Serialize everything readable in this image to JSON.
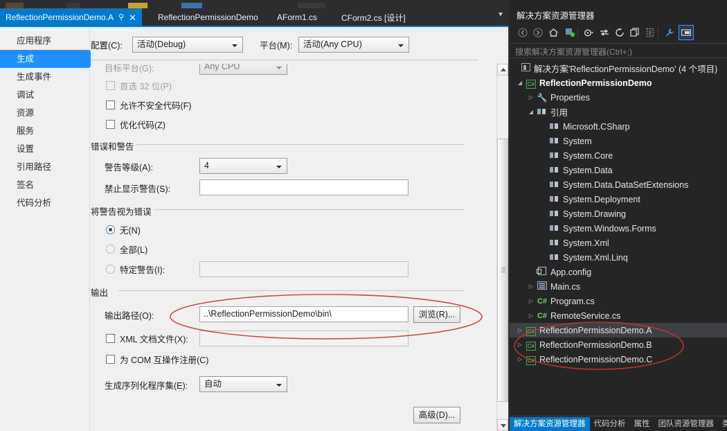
{
  "window": {
    "accent_color": "#007acc",
    "dark_bg": "#2d2d30",
    "panel_bg": "#252526",
    "light_bg": "#f0f0f0",
    "annotation_color": "#c0392b"
  },
  "tabs": {
    "items": [
      {
        "label": "ReflectionPermissionDemo.A",
        "active": true
      },
      {
        "label": "ReflectionPermissionDemo",
        "active": false
      },
      {
        "label": "AForm1.cs",
        "active": false
      },
      {
        "label": "CForm2.cs [设计]",
        "active": false
      }
    ],
    "pin_icon": "pin-icon",
    "close_icon": "close-icon",
    "overflow_icon": "chevron-down-icon"
  },
  "categories": {
    "items": [
      {
        "label": "应用程序",
        "selected": false
      },
      {
        "label": "生成",
        "selected": true
      },
      {
        "label": "生成事件",
        "selected": false
      },
      {
        "label": "调试",
        "selected": false
      },
      {
        "label": "资源",
        "selected": false
      },
      {
        "label": "服务",
        "selected": false
      },
      {
        "label": "设置",
        "selected": false
      },
      {
        "label": "引用路径",
        "selected": false
      },
      {
        "label": "签名",
        "selected": false
      },
      {
        "label": "代码分析",
        "selected": false
      }
    ]
  },
  "build_page": {
    "configuration_label": "配置(C):",
    "configuration_value": "活动(Debug)",
    "platform_label": "平台(M):",
    "platform_value": "活动(Any CPU)",
    "target_platform_label": "目标平台(G):",
    "target_platform_value": "Any CPU",
    "prefer32_label": "首选 32 位(P)",
    "prefer32_checked": false,
    "prefer32_disabled": true,
    "unsafe_label": "允许不安全代码(F)",
    "unsafe_checked": false,
    "optimize_label": "优化代码(Z)",
    "optimize_checked": false,
    "errors_group": "错误和警告",
    "warn_level_label": "警告等级(A):",
    "warn_level_value": "4",
    "suppress_warn_label": "禁止显示警告(S):",
    "suppress_warn_value": "",
    "warn_as_error_group": "将警告视为错误",
    "radio_none": "无(N)",
    "radio_all": "全部(L)",
    "radio_specific": "特定警告(I):",
    "radio_selected": "none",
    "specific_warn_value": "",
    "output_group": "输出",
    "output_path_label": "输出路径(O):",
    "output_path_value": "..\\ReflectionPermissionDemo\\bin\\",
    "browse_button": "浏览(R)...",
    "xml_doc_label": "XML 文档文件(X):",
    "xml_doc_checked": false,
    "xml_doc_value": "",
    "com_interop_label": "为 COM 互操作注册(C)",
    "com_interop_checked": false,
    "serialization_label": "生成序列化程序集(E):",
    "serialization_value": "自动",
    "advanced_button": "高级(D)..."
  },
  "solution_explorer": {
    "title": "解决方案资源管理器",
    "search_placeholder": "搜索解决方案资源管理器(Ctrl+;)",
    "toolbar": [
      {
        "name": "back-icon",
        "glyph": "◀"
      },
      {
        "name": "forward-icon",
        "glyph": "▶"
      },
      {
        "name": "home-icon",
        "glyph": "⌂"
      },
      {
        "name": "pending-changes-icon",
        "glyph": "◈"
      },
      {
        "name": "sync-views-icon",
        "glyph": "◷"
      },
      {
        "name": "refresh-icon",
        "glyph": "⇄"
      },
      {
        "name": "collapse-all-icon",
        "glyph": "⟳"
      },
      {
        "name": "show-all-files-icon",
        "glyph": "❐"
      },
      {
        "name": "preview-selected-items-icon",
        "glyph": "▤"
      },
      {
        "name": "properties-icon",
        "glyph": "🔧"
      },
      {
        "name": "properties-window-icon",
        "glyph": "▭"
      }
    ],
    "tree": [
      {
        "label": "解决方案'ReflectionPermissionDemo' (4 个项目)",
        "indent": 0,
        "twist": "none",
        "icon": "solution-icon",
        "bold": false,
        "selected": false
      },
      {
        "label": "ReflectionPermissionDemo",
        "indent": 1,
        "twist": "open",
        "icon": "csproj-icon",
        "bold": true,
        "selected": false
      },
      {
        "label": "Properties",
        "indent": 2,
        "twist": "closed",
        "icon": "wrench-icon",
        "bold": false,
        "selected": false
      },
      {
        "label": "引用",
        "indent": 2,
        "twist": "open",
        "icon": "references-icon",
        "bold": false,
        "selected": false
      },
      {
        "label": "Microsoft.CSharp",
        "indent": 3,
        "twist": "none",
        "icon": "reference-icon",
        "bold": false,
        "selected": false
      },
      {
        "label": "System",
        "indent": 3,
        "twist": "none",
        "icon": "reference-icon",
        "bold": false,
        "selected": false
      },
      {
        "label": "System.Core",
        "indent": 3,
        "twist": "none",
        "icon": "reference-icon",
        "bold": false,
        "selected": false
      },
      {
        "label": "System.Data",
        "indent": 3,
        "twist": "none",
        "icon": "reference-icon",
        "bold": false,
        "selected": false
      },
      {
        "label": "System.Data.DataSetExtensions",
        "indent": 3,
        "twist": "none",
        "icon": "reference-icon",
        "bold": false,
        "selected": false
      },
      {
        "label": "System.Deployment",
        "indent": 3,
        "twist": "none",
        "icon": "reference-icon",
        "bold": false,
        "selected": false
      },
      {
        "label": "System.Drawing",
        "indent": 3,
        "twist": "none",
        "icon": "reference-icon",
        "bold": false,
        "selected": false
      },
      {
        "label": "System.Windows.Forms",
        "indent": 3,
        "twist": "none",
        "icon": "reference-icon",
        "bold": false,
        "selected": false
      },
      {
        "label": "System.Xml",
        "indent": 3,
        "twist": "none",
        "icon": "reference-icon",
        "bold": false,
        "selected": false
      },
      {
        "label": "System.Xml.Linq",
        "indent": 3,
        "twist": "none",
        "icon": "reference-icon",
        "bold": false,
        "selected": false
      },
      {
        "label": "App.config",
        "indent": 2,
        "twist": "none",
        "icon": "config-icon",
        "bold": false,
        "selected": false
      },
      {
        "label": "Main.cs",
        "indent": 2,
        "twist": "closed",
        "icon": "form-icon",
        "bold": false,
        "selected": false
      },
      {
        "label": "Program.cs",
        "indent": 2,
        "twist": "closed",
        "icon": "cs-file-icon",
        "bold": false,
        "selected": false
      },
      {
        "label": "RemoteService.cs",
        "indent": 2,
        "twist": "closed",
        "icon": "cs-file-icon",
        "bold": false,
        "selected": false
      },
      {
        "label": "ReflectionPermissionDemo.A",
        "indent": 1,
        "twist": "closed",
        "icon": "csproj-icon",
        "bold": false,
        "selected": true
      },
      {
        "label": "ReflectionPermissionDemo.B",
        "indent": 1,
        "twist": "closed",
        "icon": "csproj-icon",
        "bold": false,
        "selected": false
      },
      {
        "label": "ReflectionPermissionDemo.C",
        "indent": 1,
        "twist": "closed",
        "icon": "csproj-icon",
        "bold": false,
        "selected": false
      }
    ],
    "bottom_tabs": [
      {
        "label": "解决方案资源管理器",
        "active": true
      },
      {
        "label": "代码分析",
        "active": false
      },
      {
        "label": "属性",
        "active": false
      },
      {
        "label": "团队资源管理器",
        "active": false
      },
      {
        "label": "类",
        "active": false
      }
    ]
  }
}
